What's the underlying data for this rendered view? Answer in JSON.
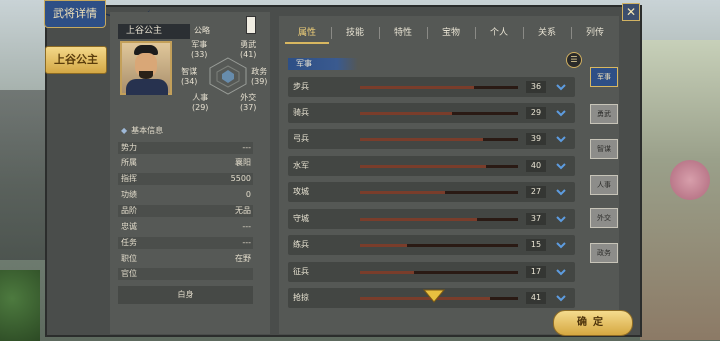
{
  "window": {
    "title": "武将详情",
    "close_label": "✕"
  },
  "officer": {
    "name_tag": "上谷公主",
    "small_name": "上谷公主"
  },
  "stats": {
    "gonglue": "公略",
    "junshi": {
      "label": "军事",
      "value": "(33)"
    },
    "yongwu": {
      "label": "勇武",
      "value": "(41)"
    },
    "zhimou": {
      "label": "智谋",
      "value": "(34)"
    },
    "zhengwu": {
      "label": "政务",
      "value": "(39)"
    },
    "renshi": {
      "label": "人事",
      "value": "(29)"
    },
    "waijiao": {
      "label": "外交",
      "value": "(37)"
    }
  },
  "basic_info": {
    "title": "基本信息",
    "rows": [
      {
        "k": "势力",
        "v": "---"
      },
      {
        "k": "所属",
        "v": "襄阳"
      },
      {
        "k": "指挥",
        "v": "5500"
      },
      {
        "k": "功绩",
        "v": "0"
      },
      {
        "k": "品阶",
        "v": "无品"
      },
      {
        "k": "忠诚",
        "v": "---"
      },
      {
        "k": "任务",
        "v": "---"
      },
      {
        "k": "职位",
        "v": "在野"
      },
      {
        "k": "官位",
        "v": ""
      }
    ],
    "identity": "白身"
  },
  "tabs": [
    "属性",
    "技能",
    "特性",
    "宝物",
    "个人",
    "关系",
    "列传"
  ],
  "active_tab": "属性",
  "section": {
    "title": "军事",
    "list_icon": "list-icon"
  },
  "skills": [
    {
      "label": "步兵",
      "value": 36
    },
    {
      "label": "骑兵",
      "value": 29
    },
    {
      "label": "弓兵",
      "value": 39
    },
    {
      "label": "水军",
      "value": 40
    },
    {
      "label": "攻城",
      "value": 27
    },
    {
      "label": "守城",
      "value": 37
    },
    {
      "label": "练兵",
      "value": 15
    },
    {
      "label": "征兵",
      "value": 17
    },
    {
      "label": "抢掠",
      "value": 41
    }
  ],
  "categories": [
    "军事",
    "勇武",
    "智谋",
    "人事",
    "外交",
    "政务"
  ],
  "active_category": "军事",
  "confirm_label": "确定",
  "colors": {
    "accent": "#2e4f86",
    "gold": "#d8b760",
    "fill": "#7a3d2b"
  }
}
